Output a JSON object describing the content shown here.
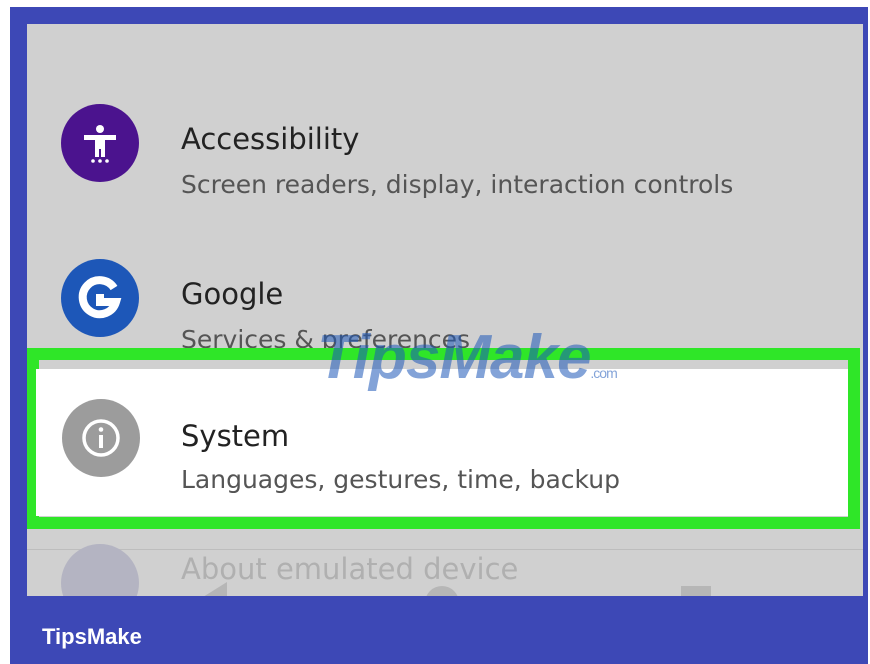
{
  "settings": {
    "items": [
      {
        "title": "Accessibility",
        "subtitle": "Screen readers, display, interaction controls",
        "icon": "accessibility-icon",
        "icon_color": "#4b138e"
      },
      {
        "title": "Google",
        "subtitle": "Services & preferences",
        "icon": "google-icon",
        "icon_color": "#1d57b8"
      },
      {
        "title": "System",
        "subtitle": "Languages, gestures, time, backup",
        "icon": "info-icon",
        "icon_color": "#9c9c9c"
      },
      {
        "title": "About emulated device",
        "subtitle": "",
        "icon": "phone-icon",
        "icon_color": "#b4b4c2"
      }
    ]
  },
  "highlight_color": "#2fe628",
  "frame_color": "#3d48b6",
  "nav": {
    "icons": [
      "back-icon",
      "home-icon",
      "recents-icon"
    ]
  },
  "watermark": {
    "text": "TipsMake",
    "suffix": ".com"
  },
  "footer": {
    "brand": "TipsMake"
  }
}
